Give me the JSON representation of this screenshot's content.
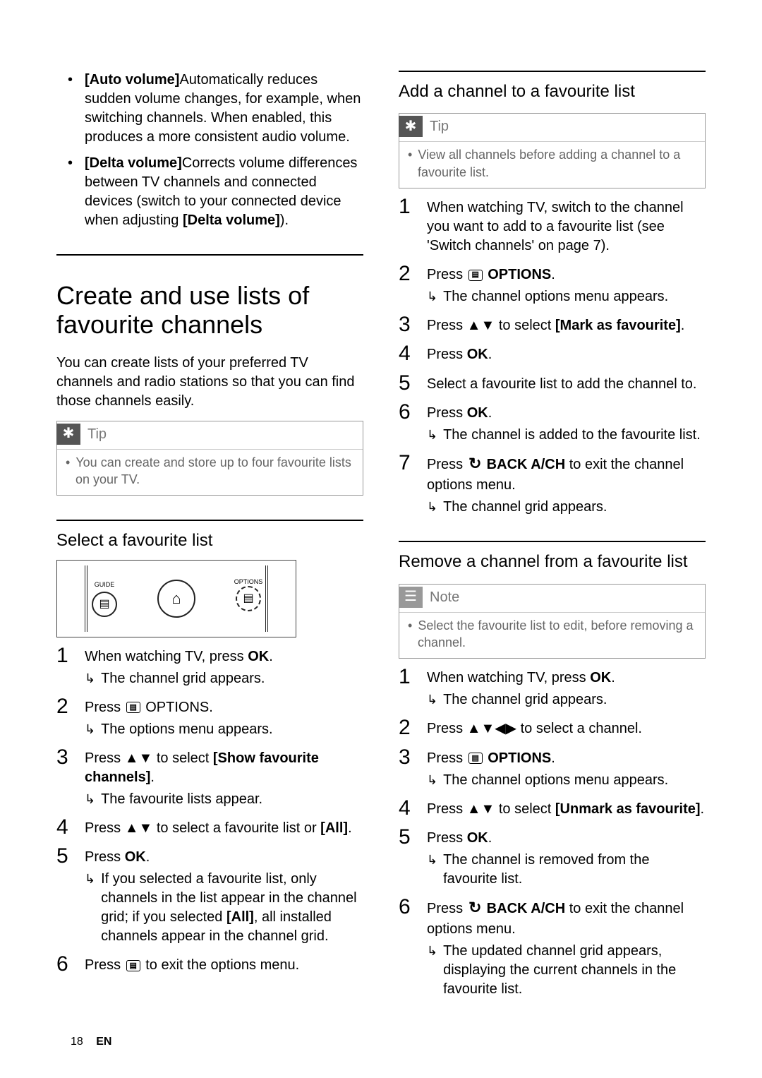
{
  "col1": {
    "bullets": [
      {
        "label": "[Auto volume]",
        "text": "Automatically reduces sudden volume changes, for example, when switching channels. When enabled, this produces a more consistent audio volume."
      },
      {
        "label": "[Delta volume]",
        "text_a": "Corrects volume differences between TV channels and connected devices (switch to your connected device when adjusting ",
        "label2": "[Delta volume]",
        "text_b": ")."
      }
    ],
    "h2": "Create and use lists of favourite channels",
    "intro": "You can create lists of your preferred TV channels and radio stations so that you can find those channels easily.",
    "tip_label": "Tip",
    "tip_body": "You can create and store up to four favourite lists on your TV.",
    "sub1": "Select a favourite list",
    "remote": {
      "guide": "GUIDE",
      "options": "OPTIONS"
    },
    "steps1": {
      "s1a": "When watching TV, press ",
      "s1b": "OK",
      "s1c": ".",
      "s1r": "The channel grid appears.",
      "s2a": "Press ",
      "s2b": " OPTIONS.",
      "s2r": "The options menu appears.",
      "s3a": "Press ",
      "s3nav": "▲▼",
      "s3b": " to select ",
      "s3c": "[Show favourite channels]",
      "s3d": ".",
      "s3r": "The favourite lists appear.",
      "s4a": "Press ",
      "s4nav": "▲▼",
      "s4b": " to select a favourite list or ",
      "s4c": "[All]",
      "s4d": ".",
      "s5a": "Press ",
      "s5b": "OK",
      "s5c": ".",
      "s5r_a": "If you selected a favourite list, only channels in the list appear in the channel grid; if you selected ",
      "s5r_b": "[All]",
      "s5r_c": ", all installed channels appear in the channel grid.",
      "s6a": "Press ",
      "s6b": " to exit the options menu."
    }
  },
  "col2": {
    "sub1": "Add a channel to a favourite list",
    "tip_label": "Tip",
    "tip_body": "View all channels before adding a channel to a favourite list.",
    "stepsA": {
      "s1": "When watching TV, switch to the channel you want to add to a favourite list (see 'Switch channels' on page 7).",
      "s2a": "Press ",
      "s2b": " OPTIONS",
      "s2c": ".",
      "s2r": "The channel options menu appears.",
      "s3a": "Press ",
      "s3nav": "▲▼",
      "s3b": " to select ",
      "s3c": "[Mark as favourite]",
      "s3d": ".",
      "s4a": "Press ",
      "s4b": "OK",
      "s4c": ".",
      "s5": "Select a favourite list to add the channel to.",
      "s6a": "Press ",
      "s6b": "OK",
      "s6c": ".",
      "s6r": "The channel is added to the favourite list.",
      "s7a": "Press ",
      "s7b": " BACK A/CH",
      "s7c": " to exit the channel options menu.",
      "s7r": "The channel grid appears."
    },
    "sub2": "Remove a channel from a favourite list",
    "note_label": "Note",
    "note_body": "Select the favourite list to edit, before removing a channel.",
    "stepsB": {
      "s1a": "When watching TV, press ",
      "s1b": "OK",
      "s1c": ".",
      "s1r": "The channel grid appears.",
      "s2a": "Press ",
      "s2nav": "▲▼◀▶",
      "s2b": " to select a channel.",
      "s3a": "Press ",
      "s3b": " OPTIONS",
      "s3c": ".",
      "s3r": "The channel options menu appears.",
      "s4a": "Press ",
      "s4nav": "▲▼",
      "s4b": " to select ",
      "s4c": "[Unmark as favourite]",
      "s4d": ".",
      "s5a": "Press ",
      "s5b": "OK",
      "s5c": ".",
      "s5r": "The channel is removed from the favourite list.",
      "s6a": "Press ",
      "s6b": " BACK A/CH",
      "s6c": " to exit the channel options menu.",
      "s6r": "The updated channel grid appears, displaying the current channels in the favourite list."
    }
  },
  "footer": {
    "page": "18",
    "lang": "EN"
  },
  "icons": {
    "options_glyph": "▤",
    "home_glyph": "⌂",
    "back_glyph": "↺",
    "asterisk": "✱",
    "note_glyph": "☰"
  }
}
